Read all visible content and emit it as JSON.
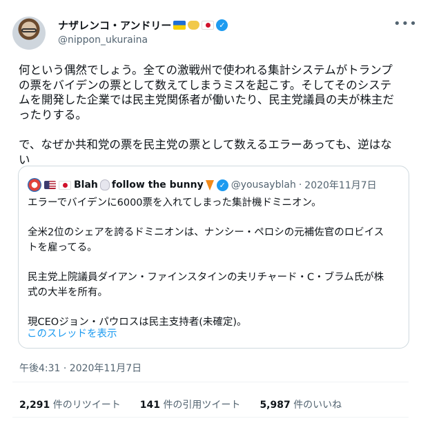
{
  "author": {
    "name": "ナザレンコ・アンドリー",
    "handle": "@nippon_ukuraina",
    "icons": [
      "ukraine-flag-icon",
      "handshake-icon",
      "japan-flag-icon",
      "verified-badge-icon"
    ]
  },
  "tweet": {
    "lines": [
      "何という偶然でしょう。全ての激戦州で使われる集計システムがトランプ",
      "の票をバイデンの票として数えてしまうミスを起こす。そしてそのシステ",
      "ムを開発した企業では民主党関係者が働いたり、民主党議員の夫が株主だ",
      "ったりする。",
      "",
      "で、なぜか共和党の票を民主党の票として数えるエラーあっても、逆はな",
      "い"
    ]
  },
  "quote": {
    "name": "Blah",
    "name_suffix": "follow the bunny",
    "handle": "@yousayblah",
    "separator": "·",
    "date": "2020年11月7日",
    "icons": [
      "avatar-icon",
      "us-flag-icon",
      "japan-flag-icon",
      "bunny-icon",
      "carrot-icon",
      "verified-badge-icon"
    ],
    "lines": [
      "エラーでバイデンに6000票を入れてしまった集計機ドミニオン。",
      "",
      "全米2位のシェアを誇るドミニオンは、ナンシー・ペロシの元補佐官のロビイス",
      "トを雇ってる。",
      "",
      "民主党上院議員ダイアン・ファインスタインの夫リチャード・C・ブラム氏が株",
      "式の大半を所有。",
      "",
      "現CEOジョン・パウロスは民主支持者(未確定)。"
    ],
    "show_thread": "このスレッドを表示"
  },
  "timestamp": "午後4:31 · 2020年11月7日",
  "stats": {
    "retweets_count": "2,291",
    "retweets_label": "件のリツイート",
    "quotes_count": "141",
    "quotes_label": "件の引用ツイート",
    "likes_count": "5,987",
    "likes_label": "件のいいね"
  },
  "colors": {
    "accent": "#1d9bf0",
    "text": "#0f1419",
    "muted": "#536471",
    "border": "#cfd9de"
  }
}
